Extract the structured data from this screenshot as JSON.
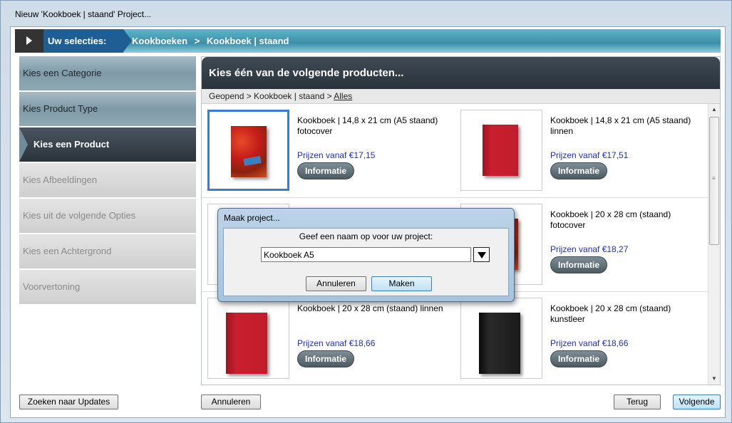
{
  "window": {
    "title": "Nieuw 'Kookboek | staand' Project..."
  },
  "breadcrumb": {
    "label": "Uw selecties:",
    "items": [
      "Kookboeken",
      ">",
      "Kookboek | staand"
    ]
  },
  "steps": [
    {
      "label": "Kies een Categorie",
      "state": "done"
    },
    {
      "label": "Kies Product Type",
      "state": "done"
    },
    {
      "label": "Kies een Product",
      "state": "active"
    },
    {
      "label": "Kies Afbeeldingen",
      "state": "todo"
    },
    {
      "label": "Kies uit de volgende Opties",
      "state": "todo"
    },
    {
      "label": "Kies een Achtergrond",
      "state": "todo"
    },
    {
      "label": "Voorvertoning",
      "state": "todo"
    }
  ],
  "main": {
    "heading": "Kies één van de volgende producten...",
    "path_prefix": "Geopend > Kookboek | staand > ",
    "path_link": "Alles"
  },
  "products": [
    {
      "title": "Kookboek | 14,8 x 21 cm (A5 staand) fotocover",
      "price": "Prijzen vanaf €17,15",
      "info": "Informatie",
      "cover": "photo-icon"
    },
    {
      "title": "Kookboek | 14,8 x 21 cm (A5 staand) linnen",
      "price": "Prijzen vanaf €17,51",
      "info": "Informatie",
      "cover": "red-book-icon"
    },
    {
      "title": "",
      "price": "",
      "info": "",
      "cover": "hidden"
    },
    {
      "title": "Kookboek | 20 x 28 cm (staand) fotocover",
      "price": "Prijzen vanaf €18,27",
      "info": "Informatie",
      "cover": "photo-icon"
    },
    {
      "title": "Kookboek | 20 x 28 cm (staand) linnen",
      "price": "Prijzen vanaf €18,66",
      "info": "Informatie",
      "cover": "red-book-icon"
    },
    {
      "title": "Kookboek | 20 x 28 cm (staand) kunstleer",
      "price": "Prijzen vanaf €18,66",
      "info": "Informatie",
      "cover": "black-book-icon"
    }
  ],
  "buttons": {
    "updates": "Zoeken naar Updates",
    "cancel": "Annuleren",
    "back": "Terug",
    "next": "Volgende"
  },
  "dialog": {
    "title": "Maak project...",
    "prompt": "Geef een naam op voor uw project:",
    "input_value": "Kookboek A5",
    "cancel": "Annuleren",
    "create": "Maken"
  },
  "colors": {
    "accent": "#1f5e93",
    "price": "#1f2fbf",
    "selection": "#3a7bd5"
  }
}
